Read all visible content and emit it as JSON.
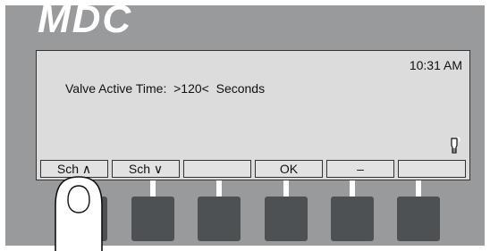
{
  "panel": {
    "brand": "MDC"
  },
  "screen": {
    "time": "10:31  AM",
    "line1": "Valve Active Time:  >120<  Seconds"
  },
  "softkeys": [
    {
      "label": "Sch ∧"
    },
    {
      "label": "Sch ∨"
    },
    {
      "label": ""
    },
    {
      "label": "OK"
    },
    {
      "label": "–"
    },
    {
      "label": ""
    }
  ],
  "icons": {
    "bulb": "lightbulb-icon",
    "finger": "pressing-finger"
  },
  "colors": {
    "panel": "#999a9c",
    "screen": "#dcdcdc",
    "buttons": "#4e5153"
  }
}
